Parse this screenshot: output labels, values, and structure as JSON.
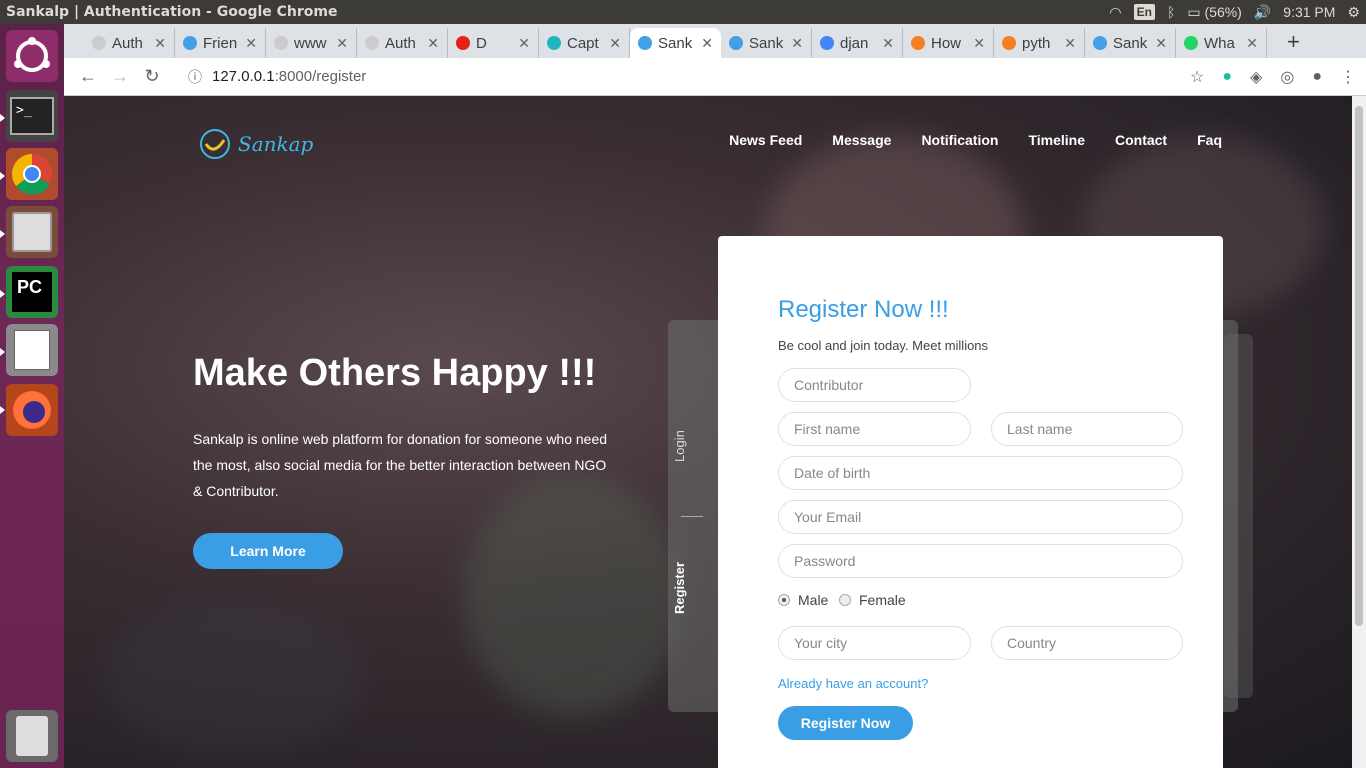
{
  "system": {
    "window_title": "Sankalp | Authentication - Google Chrome",
    "lang": "En",
    "battery": "(56%)",
    "clock": "9:31 PM"
  },
  "tabs": [
    {
      "label": "Auth",
      "favicon": "page-icon"
    },
    {
      "label": "Frien",
      "favicon": "sankalp-icon"
    },
    {
      "label": "www",
      "favicon": "page-icon"
    },
    {
      "label": "Auth",
      "favicon": "page-icon"
    },
    {
      "label": "D",
      "favicon": "youtube-icon"
    },
    {
      "label": "Capt",
      "favicon": "capture-icon"
    },
    {
      "label": "Sank",
      "favicon": "sankalp-icon",
      "active": true
    },
    {
      "label": "Sank",
      "favicon": "sankalp-icon"
    },
    {
      "label": "djan",
      "favicon": "google-icon"
    },
    {
      "label": "How",
      "favicon": "stackoverflow-icon"
    },
    {
      "label": "pyth",
      "favicon": "stackoverflow-icon"
    },
    {
      "label": "Sank",
      "favicon": "sankalp-icon"
    },
    {
      "label": "Wha",
      "favicon": "whatsapp-icon"
    }
  ],
  "address": {
    "host": "127.0.0.1",
    "rest": ":8000/register"
  },
  "site": {
    "brand": "Sankap",
    "menu": [
      "News Feed",
      "Message",
      "Notification",
      "Timeline",
      "Contact",
      "Faq"
    ],
    "hero_title": "Make Others Happy !!!",
    "hero_text": "Sankalp is online web platform for donation for someone who need the most, also social media for the better interaction between NGO & Contributor.",
    "learn_more": "Learn More",
    "side_login": "Login",
    "side_register": "Register"
  },
  "form": {
    "title": "Register Now !!!",
    "subtitle": "Be cool and join today. Meet millions",
    "role_placeholder": "Contributor",
    "first_name_placeholder": "First name",
    "last_name_placeholder": "Last name",
    "dob_placeholder": "Date of birth",
    "email_placeholder": "Your Email",
    "password_placeholder": "Password",
    "gender_male": "Male",
    "gender_female": "Female",
    "gender_selected": "Male",
    "city_placeholder": "Your city",
    "country_placeholder": "Country",
    "have_account": "Already have an account?",
    "submit": "Register Now"
  },
  "colors": {
    "accent": "#3a9ee4",
    "launcher": "#6d2855"
  }
}
